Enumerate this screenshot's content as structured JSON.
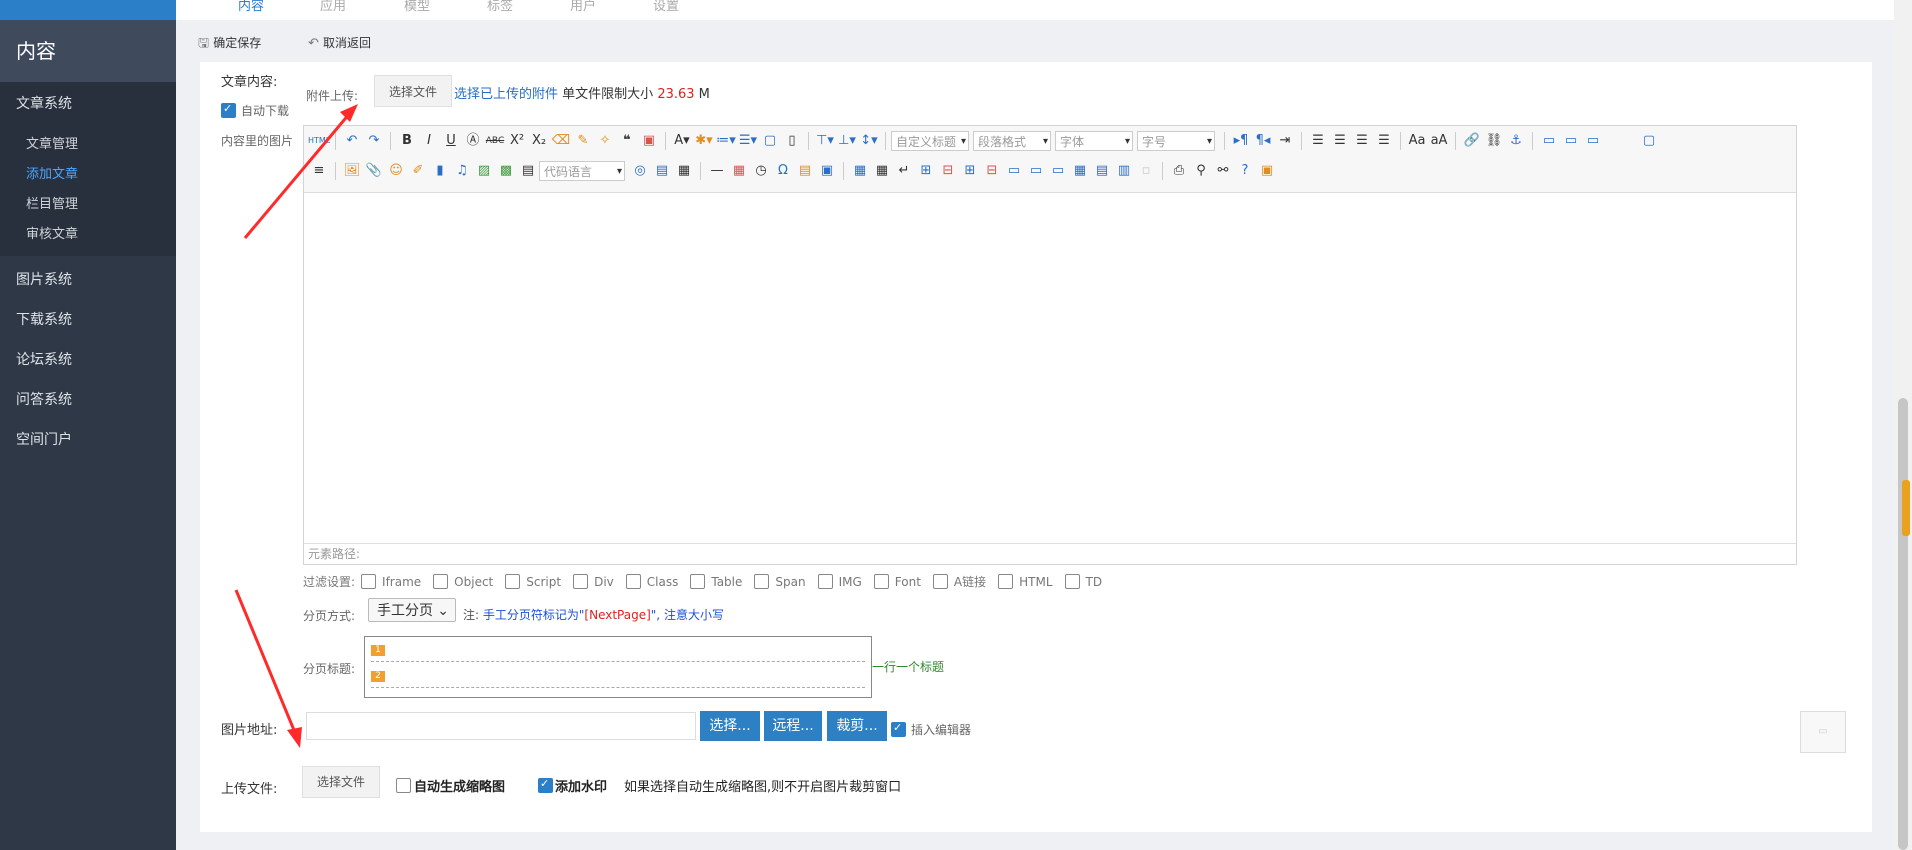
{
  "topnav": {
    "items": [
      "内容",
      "应用",
      "模型",
      "标签",
      "用户",
      "设置"
    ]
  },
  "sidebar": {
    "title": "内容",
    "groups": [
      {
        "label": "文章系统",
        "items": [
          "文章管理",
          "添加文章",
          "栏目管理",
          "审核文章"
        ]
      }
    ],
    "others": [
      "图片系统",
      "下载系统",
      "论坛系统",
      "问答系统",
      "空间门户"
    ]
  },
  "toolbar": {
    "save_label": "确定保存",
    "cancel_label": "取消返回"
  },
  "form": {
    "content_label": "文章内容:",
    "auto_download": "自动下载",
    "content_images": "内容里的图片",
    "attach_label": "附件上传:",
    "choose_file": "选择文件",
    "choose_uploaded": "选择已上传的附件",
    "size_limit_text": "单文件限制大小",
    "size_limit_value": "23.63",
    "size_unit": "M"
  },
  "editor": {
    "code_lang": "代码语言",
    "custom_title": "自定义标题",
    "para_format": "段落格式",
    "font": "字体",
    "font_size": "字号",
    "path_label": "元素路径:"
  },
  "filters": {
    "label": "过滤设置:",
    "options": [
      "Iframe",
      "Object",
      "Script",
      "Div",
      "Class",
      "Table",
      "Span",
      "IMG",
      "Font",
      "A链接",
      "HTML",
      "TD"
    ]
  },
  "paging": {
    "mode_label": "分页方式:",
    "mode_value": "手工分页",
    "note_prefix": "注:",
    "note_text": "手工分页符标记为\"",
    "note_marker": "[NextPage]",
    "note_suffix": "\",",
    "note_case": "注意大小写",
    "title_label": "分页标题:",
    "title_hint": "一行一个标题",
    "markers": [
      "1",
      "2"
    ]
  },
  "image": {
    "label": "图片地址:",
    "btn_select": "选择...",
    "btn_remote": "远程...",
    "btn_crop": "裁剪...",
    "insert_editor": "插入编辑器"
  },
  "upload": {
    "label": "上传文件:",
    "choose_file": "选择文件",
    "auto_thumb": "自动生成缩略图",
    "watermark": "添加水印",
    "hint": "如果选择自动生成缩略图,则不开启图片裁剪窗口"
  },
  "colors": {
    "accent": "#2d80c3",
    "sidebar_bg": "#2e3847",
    "danger": "#e02020",
    "arrow": "#ff2a2a"
  }
}
